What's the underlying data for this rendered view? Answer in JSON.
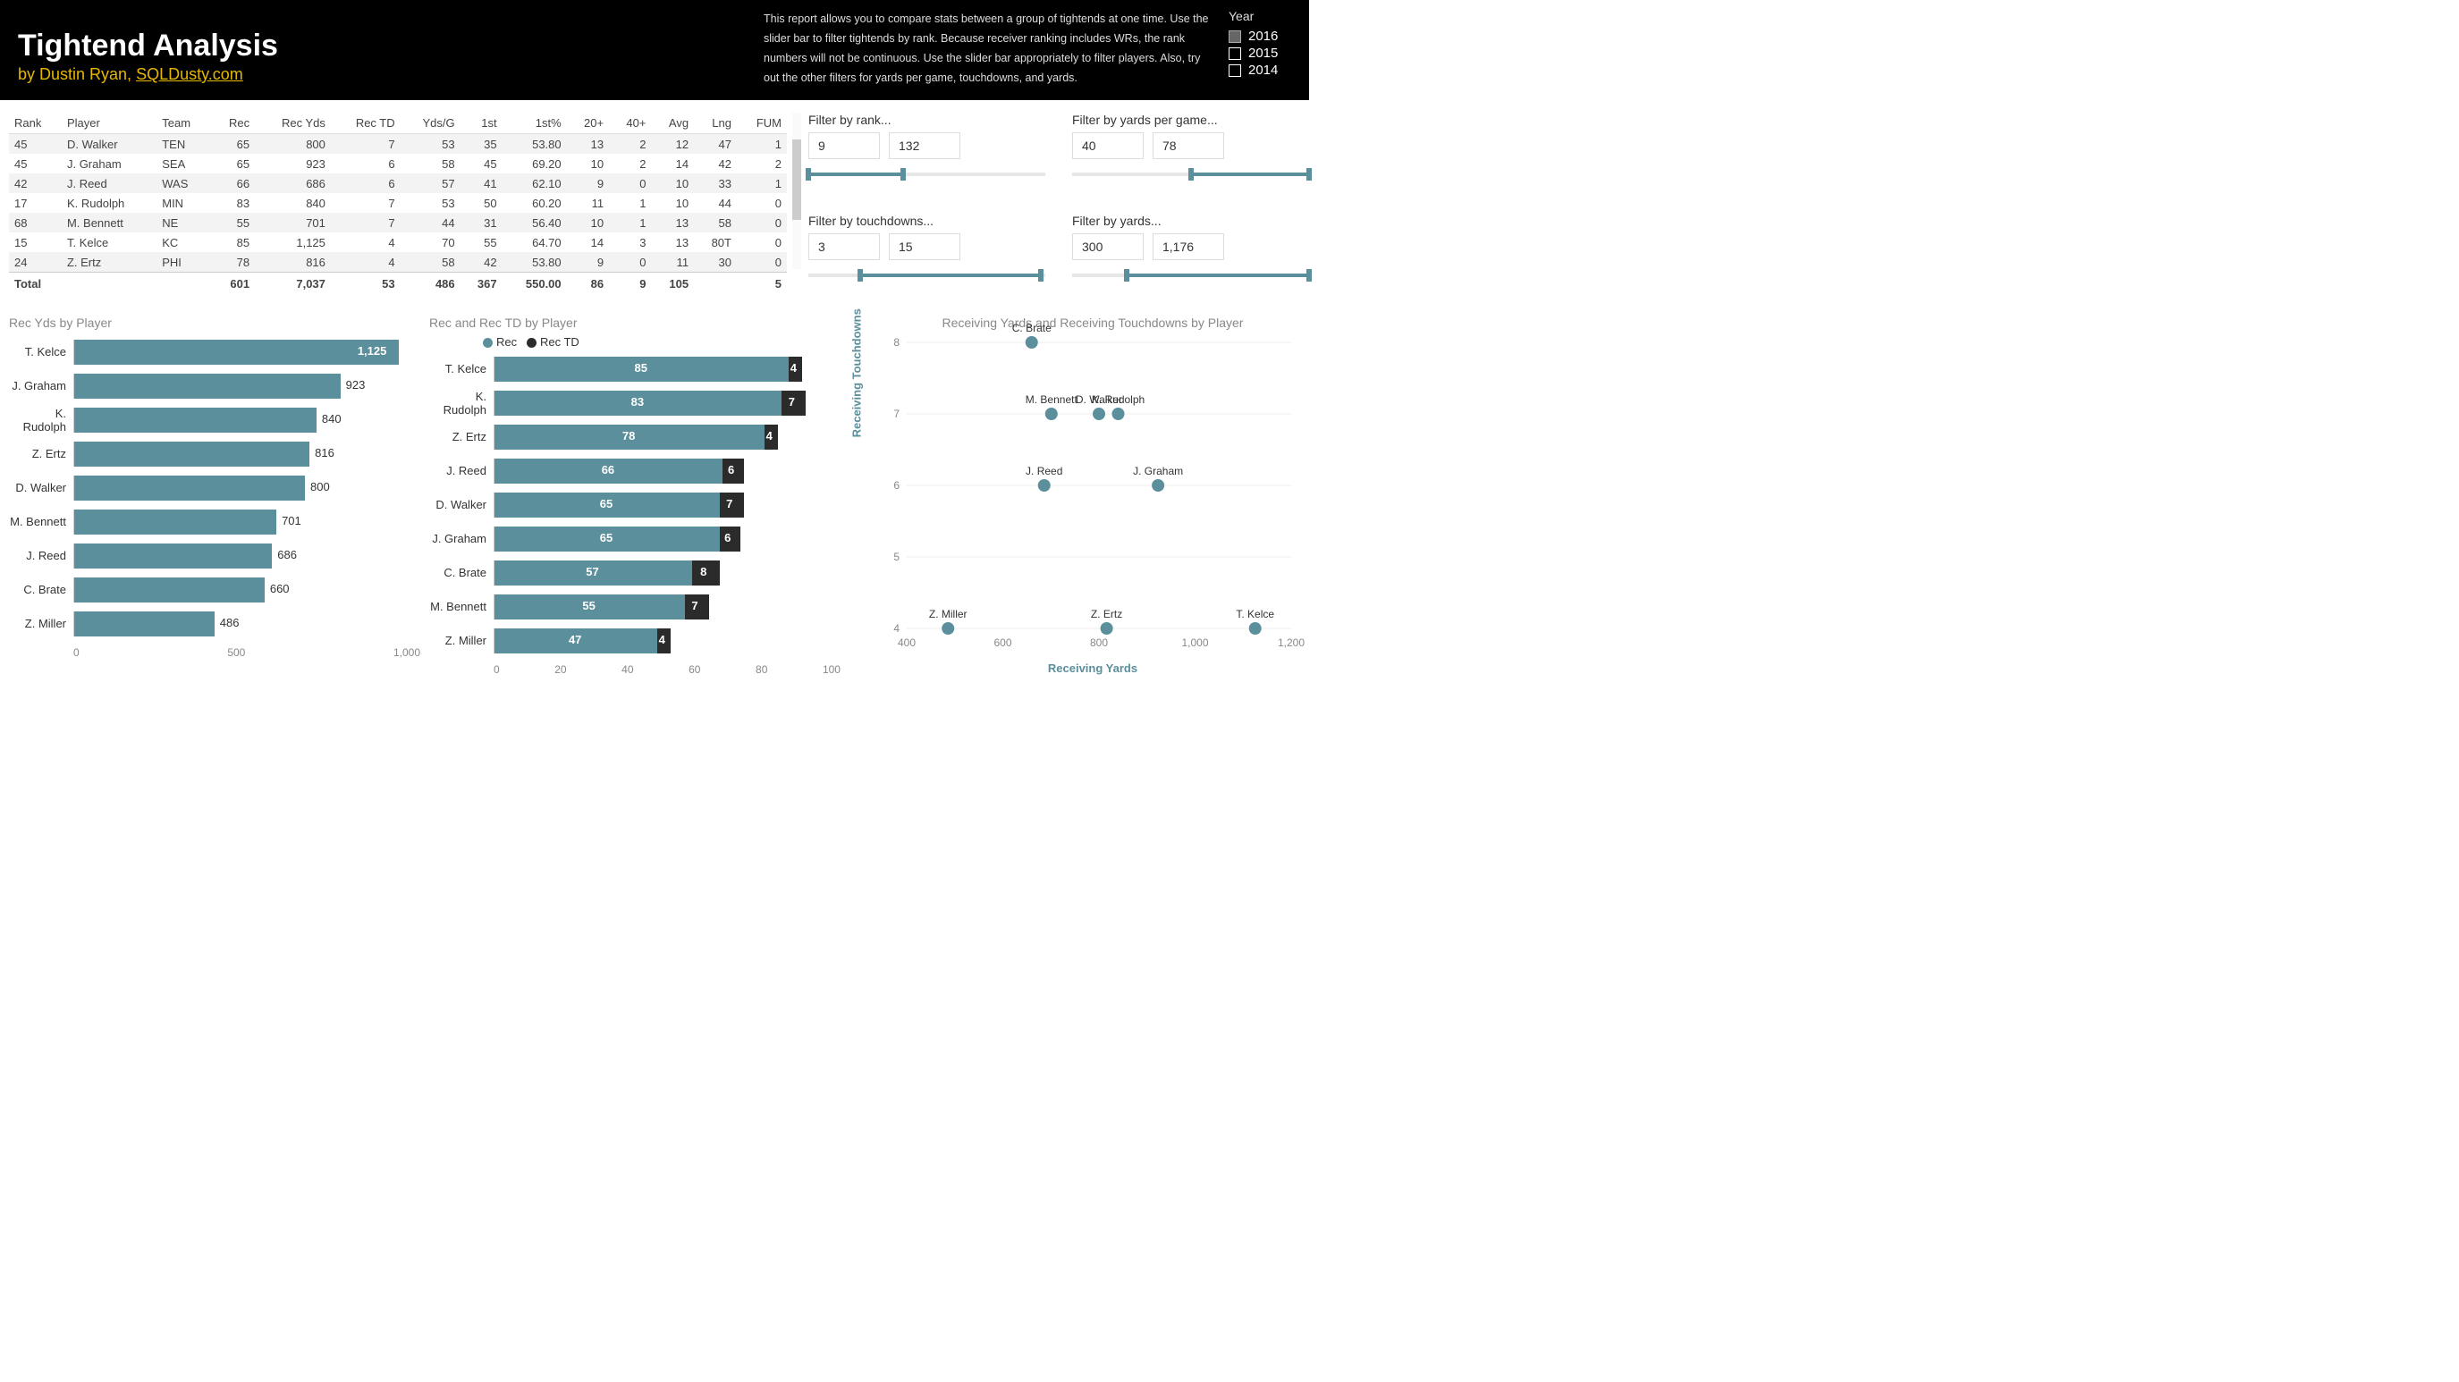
{
  "header": {
    "title": "Tightend Analysis",
    "byline_prefix": "by Dustin Ryan, ",
    "byline_link": "SQLDusty.com",
    "description": "This report allows you to compare stats between a group of tightends at one time. Use the slider bar to filter tightends by rank. Because receiver ranking includes WRs, the rank numbers will not be continuous. Use the slider bar appropriately to filter players. Also, try out the other filters for yards per game, touchdowns, and yards.",
    "year_label": "Year",
    "years": [
      {
        "label": "2016",
        "checked": true
      },
      {
        "label": "2015",
        "checked": false
      },
      {
        "label": "2014",
        "checked": false
      }
    ]
  },
  "table": {
    "headers": [
      "Rank",
      "Player",
      "Team",
      "Rec",
      "Rec Yds",
      "Rec TD",
      "Yds/G",
      "1st",
      "1st%",
      "20+",
      "40+",
      "Avg",
      "Lng",
      "FUM"
    ],
    "rows": [
      [
        "45",
        "D. Walker",
        "TEN",
        "65",
        "800",
        "7",
        "53",
        "35",
        "53.80",
        "13",
        "2",
        "12",
        "47",
        "1"
      ],
      [
        "45",
        "J. Graham",
        "SEA",
        "65",
        "923",
        "6",
        "58",
        "45",
        "69.20",
        "10",
        "2",
        "14",
        "42",
        "2"
      ],
      [
        "42",
        "J. Reed",
        "WAS",
        "66",
        "686",
        "6",
        "57",
        "41",
        "62.10",
        "9",
        "0",
        "10",
        "33",
        "1"
      ],
      [
        "17",
        "K. Rudolph",
        "MIN",
        "83",
        "840",
        "7",
        "53",
        "50",
        "60.20",
        "11",
        "1",
        "10",
        "44",
        "0"
      ],
      [
        "68",
        "M. Bennett",
        "NE",
        "55",
        "701",
        "7",
        "44",
        "31",
        "56.40",
        "10",
        "1",
        "13",
        "58",
        "0"
      ],
      [
        "15",
        "T. Kelce",
        "KC",
        "85",
        "1,125",
        "4",
        "70",
        "55",
        "64.70",
        "14",
        "3",
        "13",
        "80T",
        "0"
      ],
      [
        "24",
        "Z. Ertz",
        "PHI",
        "78",
        "816",
        "4",
        "58",
        "42",
        "53.80",
        "9",
        "0",
        "11",
        "30",
        "0"
      ]
    ],
    "total": [
      "Total",
      "",
      "",
      "601",
      "7,037",
      "53",
      "486",
      "367",
      "550.00",
      "86",
      "9",
      "105",
      "",
      "5"
    ]
  },
  "filters": {
    "rank": {
      "label": "Filter by rank...",
      "lo": "9",
      "hi": "132",
      "loPct": 0,
      "hiPct": 40
    },
    "ypg": {
      "label": "Filter by yards per game...",
      "lo": "40",
      "hi": "78",
      "loPct": 50,
      "hiPct": 100
    },
    "td": {
      "label": "Filter by touchdowns...",
      "lo": "3",
      "hi": "15",
      "loPct": 22,
      "hiPct": 98
    },
    "yards": {
      "label": "Filter by yards...",
      "lo": "300",
      "hi": "1,176",
      "loPct": 23,
      "hiPct": 100
    }
  },
  "chart_data": [
    {
      "id": "rec_yds_by_player",
      "type": "bar",
      "orientation": "horizontal",
      "title": "Rec Yds by Player",
      "xlabel": "",
      "ylabel": "",
      "xlim": [
        0,
        1200
      ],
      "ticks": [
        "0",
        "500",
        "1,000"
      ],
      "categories": [
        "T. Kelce",
        "J. Graham",
        "K. Rudolph",
        "Z. Ertz",
        "D. Walker",
        "M. Bennett",
        "J. Reed",
        "C. Brate",
        "Z. Miller"
      ],
      "values": [
        1125,
        923,
        840,
        816,
        800,
        701,
        686,
        660,
        486
      ],
      "color": "#5a8f9b"
    },
    {
      "id": "rec_and_td_by_player",
      "type": "bar",
      "orientation": "horizontal",
      "title": "Rec and Rec TD by Player",
      "xlabel": "",
      "ylabel": "",
      "xlim": [
        0,
        100
      ],
      "ticks": [
        "0",
        "20",
        "40",
        "60",
        "80",
        "100"
      ],
      "legend": [
        {
          "name": "Rec",
          "color": "#5a8f9b"
        },
        {
          "name": "Rec TD",
          "color": "#2b2b2b"
        }
      ],
      "categories": [
        "T. Kelce",
        "K. Rudolph",
        "Z. Ertz",
        "J. Reed",
        "D. Walker",
        "J. Graham",
        "C. Brate",
        "M. Bennett",
        "Z. Miller"
      ],
      "series": [
        {
          "name": "Rec",
          "values": [
            85,
            83,
            78,
            66,
            65,
            65,
            57,
            55,
            47
          ],
          "color": "#5a8f9b"
        },
        {
          "name": "Rec TD",
          "values": [
            4,
            7,
            4,
            6,
            7,
            6,
            8,
            7,
            4
          ],
          "color": "#2b2b2b"
        }
      ]
    },
    {
      "id": "scatter_yds_td",
      "type": "scatter",
      "title": "Receiving Yards and Receiving Touchdowns by Player",
      "xlabel": "Receiving Yards",
      "ylabel": "Receiving Touchdowns",
      "xlim": [
        400,
        1200
      ],
      "ylim": [
        4,
        8
      ],
      "xticks": [
        "400",
        "600",
        "800",
        "1,000",
        "1,200"
      ],
      "yticks": [
        "4",
        "5",
        "6",
        "7",
        "8"
      ],
      "points": [
        {
          "label": "C. Brate",
          "x": 660,
          "y": 8
        },
        {
          "label": "K. Rudolph",
          "x": 840,
          "y": 7
        },
        {
          "label": "M. Bennett",
          "x": 701,
          "y": 7
        },
        {
          "label": "D. Walker",
          "x": 800,
          "y": 7
        },
        {
          "label": "J. Reed",
          "x": 686,
          "y": 6
        },
        {
          "label": "J. Graham",
          "x": 923,
          "y": 6
        },
        {
          "label": "Z. Miller",
          "x": 486,
          "y": 4
        },
        {
          "label": "Z. Ertz",
          "x": 816,
          "y": 4
        },
        {
          "label": "T. Kelce",
          "x": 1125,
          "y": 4
        }
      ],
      "color": "#5a8f9b"
    }
  ]
}
